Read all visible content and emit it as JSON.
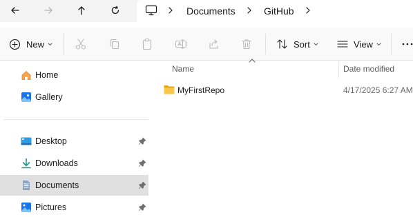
{
  "address": {
    "root_icon": "monitor-icon",
    "segments": [
      "Documents",
      "GitHub"
    ]
  },
  "nav": {
    "back_icon": "arrow-left-icon",
    "forward_icon": "arrow-right-icon",
    "up_icon": "arrow-up-icon",
    "refresh_icon": "refresh-icon"
  },
  "toolbar": {
    "new_label": "New",
    "sort_label": "Sort",
    "view_label": "View",
    "more_label": "···",
    "action_icons": [
      "cut-icon",
      "copy-icon",
      "paste-icon",
      "rename-icon",
      "share-icon",
      "delete-icon"
    ]
  },
  "sidebar": {
    "items": [
      {
        "label": "Home",
        "icon": "home-icon",
        "pinned": false,
        "selected": false
      },
      {
        "label": "Gallery",
        "icon": "gallery-icon",
        "pinned": false,
        "selected": false
      },
      {
        "label": "Desktop",
        "icon": "desktop-icon",
        "pinned": true,
        "selected": false
      },
      {
        "label": "Downloads",
        "icon": "download-icon",
        "pinned": true,
        "selected": false
      },
      {
        "label": "Documents",
        "icon": "documents-icon",
        "pinned": true,
        "selected": true
      },
      {
        "label": "Pictures",
        "icon": "pictures-icon",
        "pinned": true,
        "selected": false
      }
    ]
  },
  "files": {
    "columns": {
      "name": "Name",
      "date_modified": "Date modified"
    },
    "rows": [
      {
        "name": "MyFirstRepo",
        "date_modified": "4/17/2025 6:27 AM",
        "icon": "folder-icon"
      }
    ]
  },
  "colors": {
    "selected_bg": "#e0e0e0",
    "folder": "#f8c74a",
    "accent_blue": "#1a73e8"
  }
}
